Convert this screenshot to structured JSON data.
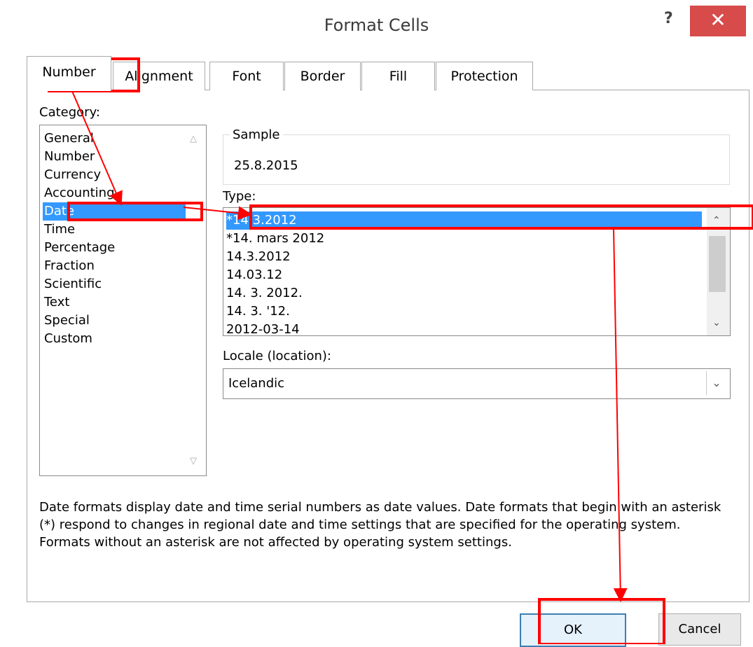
{
  "window": {
    "title": "Format Cells",
    "help_label": "?",
    "close_label": "✕"
  },
  "tabs": [
    {
      "label": "Number",
      "active": true
    },
    {
      "label": "Alignment",
      "active": false
    },
    {
      "label": "Font",
      "active": false
    },
    {
      "label": "Border",
      "active": false
    },
    {
      "label": "Fill",
      "active": false
    },
    {
      "label": "Protection",
      "active": false
    }
  ],
  "category": {
    "label": "Category:",
    "items": [
      "General",
      "Number",
      "Currency",
      "Accounting",
      "Date",
      "Time",
      "Percentage",
      "Fraction",
      "Scientific",
      "Text",
      "Special",
      "Custom"
    ],
    "selected": "Date"
  },
  "sample": {
    "label": "Sample",
    "value": "25.8.2015"
  },
  "type": {
    "label": "Type:",
    "items": [
      "*14.3.2012",
      "*14. mars 2012",
      "14.3.2012",
      "14.03.12",
      "14. 3. 2012.",
      "14. 3. '12.",
      "2012-03-14"
    ],
    "selected": "*14.3.2012"
  },
  "locale": {
    "label": "Locale (location):",
    "value": "Icelandic"
  },
  "description": "Date formats display date and time serial numbers as date values.  Date formats that begin with an asterisk (*) respond to changes in regional date and time settings that are specified for the operating system. Formats without an asterisk are not affected by operating system settings.",
  "buttons": {
    "ok": "OK",
    "cancel": "Cancel"
  },
  "annotation_color": "#ff0000",
  "selection_color": "#3399ff"
}
